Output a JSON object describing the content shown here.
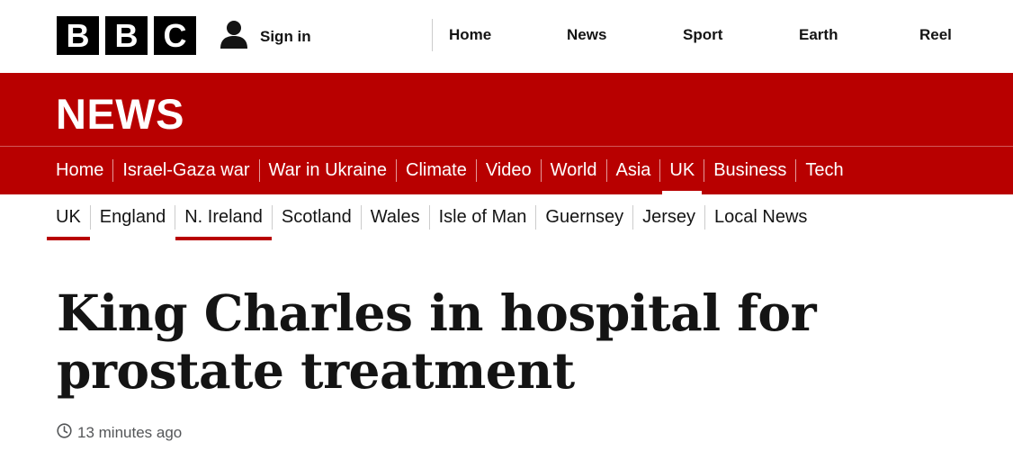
{
  "brand": {
    "logo_letters": [
      "B",
      "B",
      "C"
    ]
  },
  "account": {
    "signin_label": "Sign in",
    "icon": "user-icon"
  },
  "top_nav": [
    "Home",
    "News",
    "Sport",
    "Earth",
    "Reel"
  ],
  "masthead": {
    "title": "NEWS",
    "background": "#b80000"
  },
  "section_nav": {
    "items": [
      "Home",
      "Israel-Gaza war",
      "War in Ukraine",
      "Climate",
      "Video",
      "World",
      "Asia",
      "UK",
      "Business",
      "Tech"
    ],
    "active": "UK"
  },
  "sub_nav": {
    "items": [
      "UK",
      "England",
      "N. Ireland",
      "Scotland",
      "Wales",
      "Isle of Man",
      "Guernsey",
      "Jersey",
      "Local News"
    ],
    "highlighted": [
      "UK",
      "N. Ireland"
    ]
  },
  "article": {
    "headline": "King Charles in hospital for prostate treatment",
    "timestamp": "13 minutes ago",
    "timestamp_icon": "clock-icon"
  }
}
